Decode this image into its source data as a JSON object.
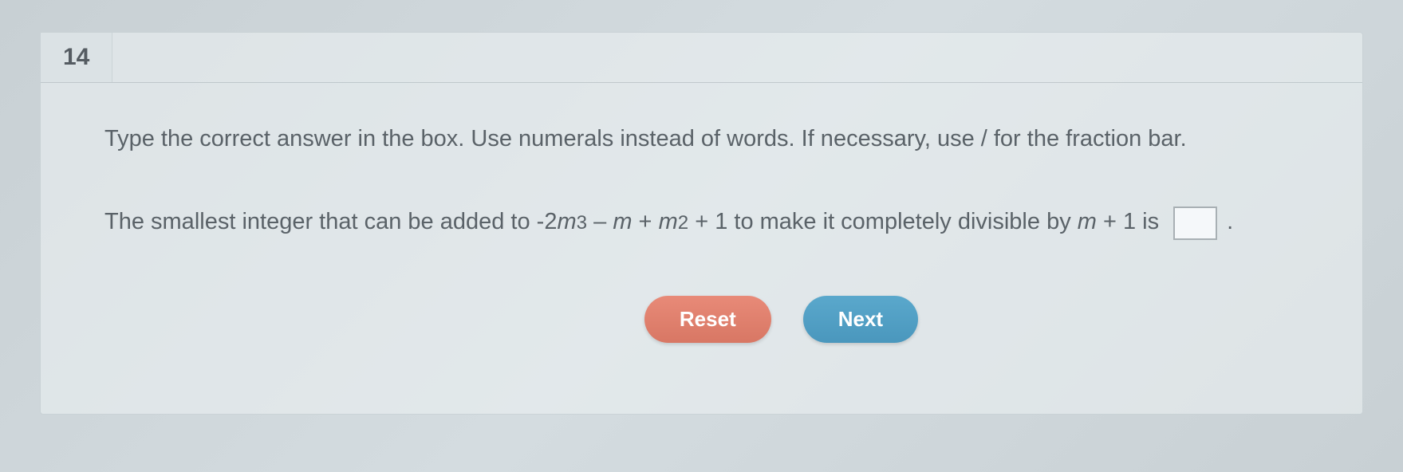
{
  "question": {
    "number": "14",
    "instructions": "Type the correct answer in the box. Use numerals instead of words. If necessary, use / for the fraction bar.",
    "text_part1": "The smallest integer that can be added to -2",
    "text_var1": "m",
    "text_exp1": "3",
    "text_part2": " – ",
    "text_var2": "m",
    "text_part3": " + ",
    "text_var3": "m",
    "text_exp2": "2",
    "text_part4": " + 1 to make it completely divisible by ",
    "text_var4": "m",
    "text_part5": " + 1 is",
    "answer_value": "",
    "period": "."
  },
  "buttons": {
    "reset": "Reset",
    "next": "Next"
  }
}
